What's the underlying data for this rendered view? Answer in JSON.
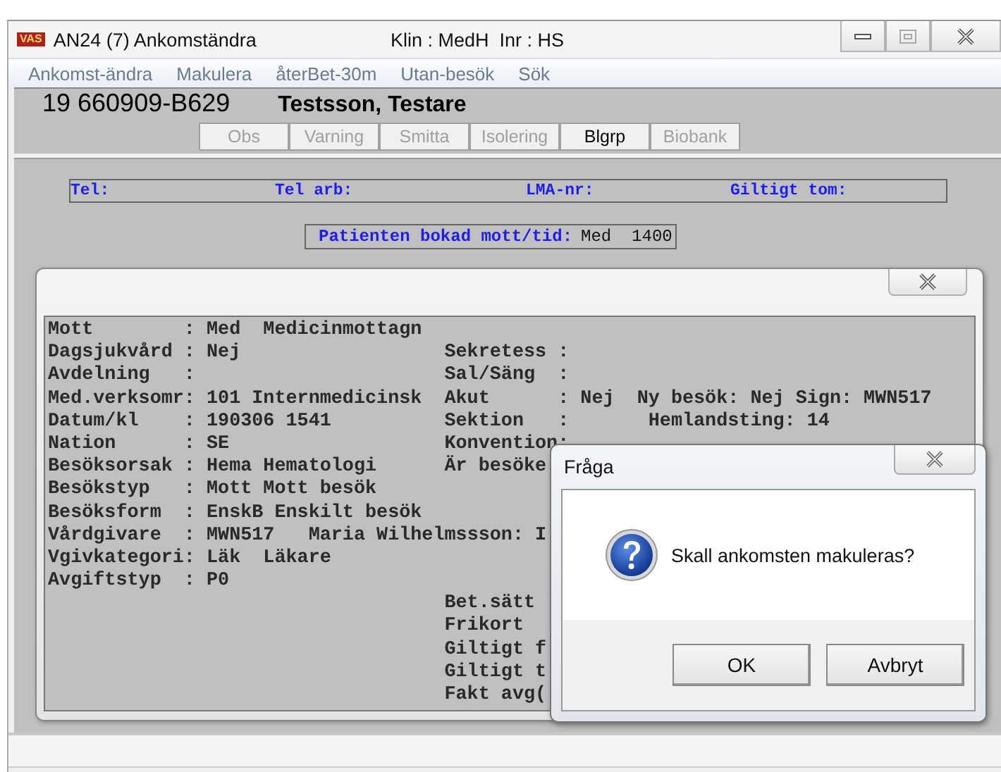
{
  "window": {
    "badge": "VAS",
    "title": "AN24 (7) Ankomständra",
    "context": "Klin : MedH  Inr : HS"
  },
  "menu": [
    "Ankomst-ändra",
    "Makulera",
    "återBet-30m",
    "Utan-besök",
    "Sök"
  ],
  "patient": {
    "id": "19 660909-B629",
    "name": "Testsson, Testare"
  },
  "flag_buttons": [
    {
      "label": "Obs",
      "disabled": true
    },
    {
      "label": "Varning",
      "disabled": true
    },
    {
      "label": "Smitta",
      "disabled": true
    },
    {
      "label": "Isolering",
      "disabled": true
    },
    {
      "label": "Blgrp",
      "disabled": false
    },
    {
      "label": "Biobank",
      "disabled": true
    }
  ],
  "contact_fields": [
    "Tel:",
    "Tel arb:",
    "LMA-nr:",
    "Giltigt tom:"
  ],
  "booking": {
    "label": "Patienten bokad mott/tid:",
    "value": "Med  1400"
  },
  "visit_dialog": {
    "rows": [
      {
        "left": "Mott        : Med  Medicinmottagn",
        "right": ""
      },
      {
        "left": "Dagsjukvård : Nej",
        "right": "Sekretess :"
      },
      {
        "left": "Avdelning   :",
        "right": "Sal/Säng  :"
      },
      {
        "left": "Med.verksomr: 101 Internmedicinsk",
        "right": "Akut      : Nej  Ny besök: Nej Sign: MWN517"
      },
      {
        "left": "Datum/kl    : 190306 1541",
        "right": "Sektion   :       Hemlandsting: 14"
      },
      {
        "left": "Nation      : SE",
        "right": "Konvention:"
      },
      {
        "left": "Besöksorsak : Hema Hematologi",
        "right": "Är besöke"
      },
      {
        "left": "Besökstyp   : Mott Mott besök",
        "right": ""
      },
      {
        "left": "Besöksform  : EnskB Enskilt besök",
        "right": ""
      },
      {
        "left": "Vårdgivare  : MWN517   Maria Wilhelmssson: I",
        "right": ""
      },
      {
        "left": "Vgivkategori: Läk  Läkare",
        "right": ""
      },
      {
        "left": "Avgiftstyp  : P0",
        "right": ""
      },
      {
        "left": "",
        "right": "Bet.sätt"
      },
      {
        "left": "",
        "right": "Frikort"
      },
      {
        "left": "",
        "right": "Giltigt f"
      },
      {
        "left": "",
        "right": "Giltigt t"
      },
      {
        "left": "",
        "right": "Fakt avg("
      }
    ]
  },
  "confirm_dialog": {
    "title": "Fråga",
    "message": "Skall ankomsten makuleras?",
    "buttons": [
      "OK",
      "Avbryt"
    ]
  }
}
